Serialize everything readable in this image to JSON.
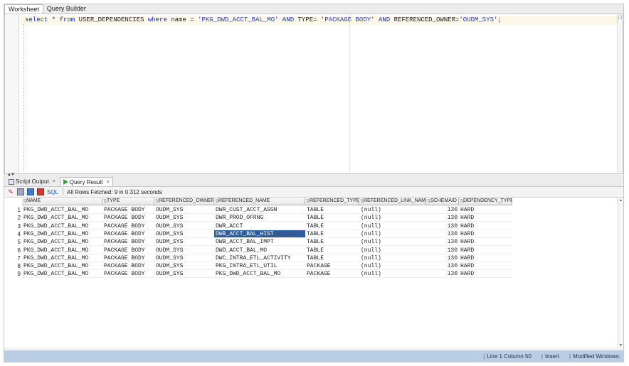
{
  "editor_tabs": [
    {
      "label": "Worksheet",
      "active": true
    },
    {
      "label": "Query Builder",
      "active": false
    }
  ],
  "sql": {
    "kw_select": "select",
    "star": " * ",
    "kw_from": "from",
    "table": " USER_DEPENDENCIES ",
    "kw_where": "where",
    "col_name": " name = ",
    "val_name": "'PKG_DWD_ACCT_BAL_MO'",
    "and1": " AND ",
    "col_type": "TYPE= ",
    "val_type": "'PACKAGE BODY'",
    "and2": " AND ",
    "col_owner": "REFERENCED_OWNER=",
    "val_owner": "'OUDM_SYS'",
    "end": ";"
  },
  "result_tabs": [
    {
      "label": "Script Output",
      "close": "×",
      "active": false
    },
    {
      "label": "Query Result",
      "close": "×",
      "active": true
    }
  ],
  "toolbar": {
    "sql_label": "SQL",
    "status": "All Rows Fetched: 9 in 0.312 seconds"
  },
  "grid": {
    "columns": [
      "NAME",
      "TYPE",
      "REFERENCED_OWNER",
      "REFERENCED_NAME",
      "REFERENCED_TYPE",
      "REFERENCED_LINK_NAME",
      "SCHEMAID",
      "DEPENDENCY_TYPE"
    ],
    "rows": [
      {
        "n": "1",
        "c": [
          "PKG_DWD_ACCT_BAL_MO",
          "PACKAGE BODY",
          "OUDM_SYS",
          "DWR_CUST_ACCT_ASGN",
          "TABLE",
          "(null)",
          "130",
          "HARD"
        ]
      },
      {
        "n": "2",
        "c": [
          "PKG_DWD_ACCT_BAL_MO",
          "PACKAGE BODY",
          "OUDM_SYS",
          "DWR_PROD_OFRNG",
          "TABLE",
          "(null)",
          "130",
          "HARD"
        ]
      },
      {
        "n": "3",
        "c": [
          "PKG_DWD_ACCT_BAL_MO",
          "PACKAGE BODY",
          "OUDM_SYS",
          "DWR_ACCT",
          "TABLE",
          "(null)",
          "130",
          "HARD"
        ]
      },
      {
        "n": "4",
        "c": [
          "PKG_DWD_ACCT_BAL_MO",
          "PACKAGE BODY",
          "OUDM_SYS",
          "DWB_ACCT_BAL_HIST",
          "TABLE",
          "(null)",
          "130",
          "HARD"
        ]
      },
      {
        "n": "5",
        "c": [
          "PKG_DWD_ACCT_BAL_MO",
          "PACKAGE BODY",
          "OUDM_SYS",
          "DWB_ACCT_BAL_IMPT",
          "TABLE",
          "(null)",
          "130",
          "HARD"
        ]
      },
      {
        "n": "6",
        "c": [
          "PKG_DWD_ACCT_BAL_MO",
          "PACKAGE BODY",
          "OUDM_SYS",
          "DWD_ACCT_BAL_MO",
          "TABLE",
          "(null)",
          "130",
          "HARD"
        ]
      },
      {
        "n": "7",
        "c": [
          "PKG_DWD_ACCT_BAL_MO",
          "PACKAGE BODY",
          "OUDM_SYS",
          "DWC_INTRA_ETL_ACTIVITY",
          "TABLE",
          "(null)",
          "130",
          "HARD"
        ]
      },
      {
        "n": "8",
        "c": [
          "PKG_DWD_ACCT_BAL_MO",
          "PACKAGE BODY",
          "OUDM_SYS",
          "PKG_INTRA_ETL_UTIL",
          "PACKAGE",
          "(null)",
          "130",
          "HARD"
        ]
      },
      {
        "n": "9",
        "c": [
          "PKG_DWD_ACCT_BAL_MO",
          "PACKAGE BODY",
          "OUDM_SYS",
          "PKG_DWD_ACCT_BAL_MO",
          "PACKAGE",
          "(null)",
          "130",
          "HARD"
        ]
      }
    ],
    "selected": {
      "row": 4,
      "col": "REFERENCED_NAME"
    }
  },
  "statusbar": {
    "position": "Line 1 Column 50",
    "mode": "Insert",
    "modified": "Modified",
    "line_ending": "Windows:"
  },
  "colors": {
    "keyword": "#1b26c8",
    "selection": "#2d5c98",
    "statusbar": "#b9cde3"
  },
  "icons": [
    "pin-icon",
    "print-icon",
    "export-icon",
    "export-excel-icon",
    "play-icon",
    "script-icon"
  ]
}
